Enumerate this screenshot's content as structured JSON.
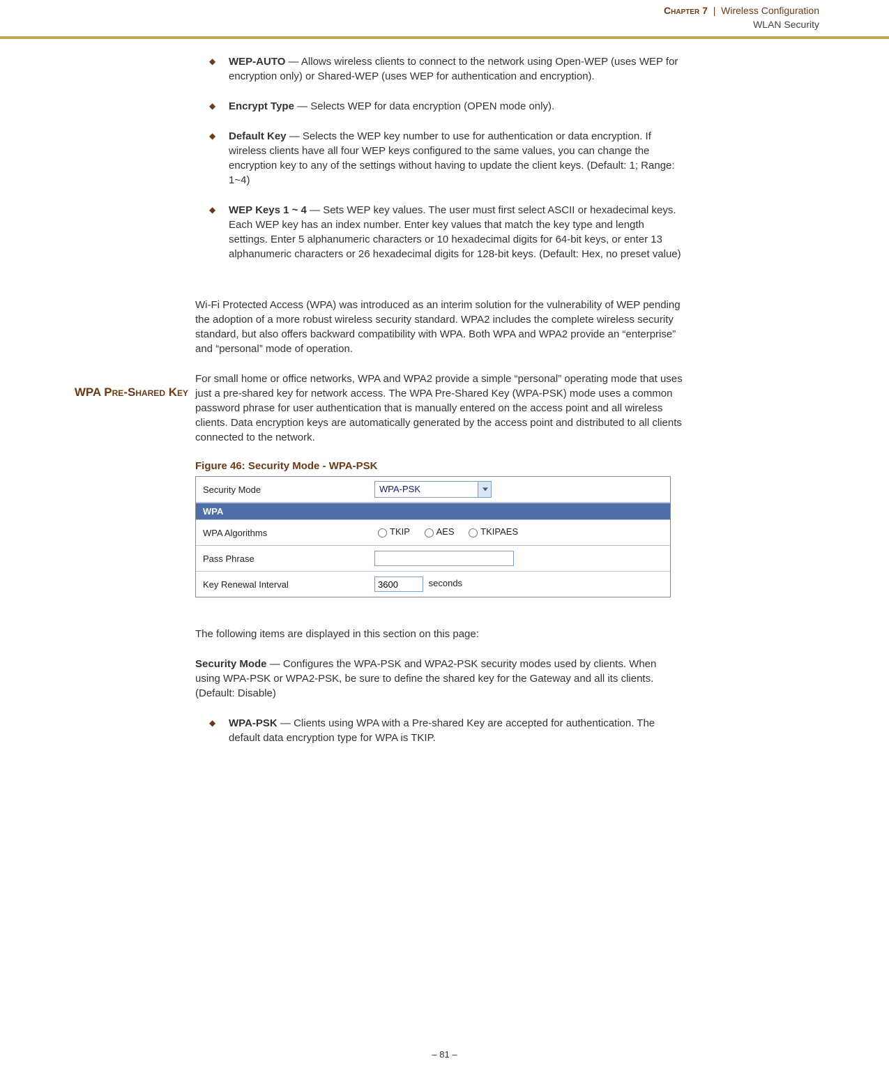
{
  "header": {
    "chapter_label": "Chapter 7",
    "chapter_title": "Wireless Configuration",
    "section": "WLAN Security"
  },
  "list1": {
    "item0": {
      "term": "WEP-AUTO",
      "text": " — Allows wireless clients to connect to the network using Open-WEP (uses WEP for encryption only) or Shared-WEP (uses WEP for authentication and encryption)."
    },
    "item1": {
      "term": "Encrypt Type",
      "text": " — Selects WEP for data encryption (OPEN mode only)."
    },
    "item2": {
      "term": "Default Key",
      "text": " — Selects the WEP key number to use for authentication or data encryption. If wireless clients have all four WEP keys configured to the same values, you can change the encryption key to any of the settings without having to update the client keys. (Default: 1; Range: 1~4)"
    },
    "item3": {
      "term": "WEP Keys 1 ~ 4",
      "text": " — Sets WEP key values. The user must first select ASCII or hexadecimal keys. Each WEP key has an index number. Enter key values that match the key type and length settings. Enter 5 alphanumeric characters or 10 hexadecimal digits for 64-bit keys, or enter 13 alphanumeric characters or 26 hexadecimal digits for 128-bit keys. (Default: Hex, no preset value)"
    }
  },
  "side_heading": "WPA Pre-Shared Key",
  "para1": "Wi-Fi Protected Access (WPA) was introduced as an interim solution for the vulnerability of WEP pending the adoption of a more robust wireless security standard. WPA2 includes the complete wireless security standard, but also offers backward compatibility with WPA. Both WPA and WPA2 provide an “enterprise” and “personal” mode of operation.",
  "para2": "For small home or office networks, WPA and WPA2 provide a simple “personal” operating mode that uses just a pre-shared key for network access. The WPA Pre-Shared Key (WPA-PSK) mode uses a common password phrase for user authentication that is manually entered on the access point and all wireless clients. Data encryption keys are automatically generated by the access point and distributed to all clients connected to the network.",
  "figure": {
    "caption": "Figure 46:  Security Mode - WPA-PSK",
    "security_mode_label": "Security Mode",
    "security_mode_value": "WPA-PSK",
    "wpa_header": "WPA",
    "algos_label": "WPA Algorithms",
    "algo_tkip": "TKIP",
    "algo_aes": "AES",
    "algo_tkipaes": "TKIPAES",
    "pass_label": "Pass Phrase",
    "pass_value": "",
    "renew_label": "Key Renewal Interval",
    "renew_value": "3600",
    "renew_unit": "seconds"
  },
  "para3": "The following items are displayed in this section on this page:",
  "secmode": {
    "term": "Security Mode",
    "text": " — Configures the WPA-PSK and WPA2-PSK security modes used by clients. When using WPA-PSK or WPA2-PSK, be sure to define the shared key for the Gateway and all its clients. (Default: Disable)"
  },
  "list2": {
    "item0": {
      "term": "WPA-PSK",
      "text": " — Clients using WPA with a Pre-shared Key are accepted for authentication. The default data encryption type for WPA is TKIP."
    }
  },
  "footer": "–  81  –"
}
